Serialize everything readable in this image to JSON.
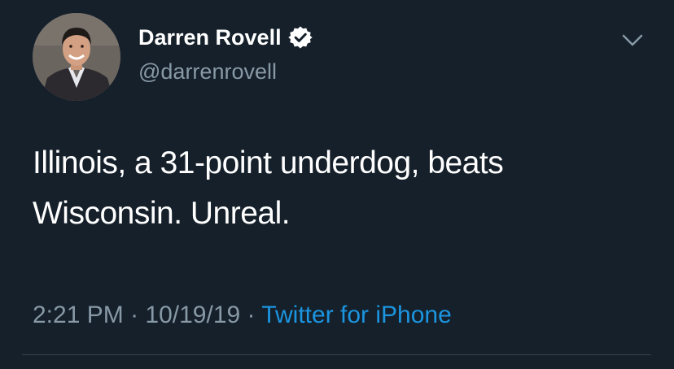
{
  "author": {
    "display_name": "Darren Rovell",
    "handle": "@darrenrovell",
    "verified": true
  },
  "tweet": {
    "text": "Illinois, a 31-point underdog, beats Wisconsin. Unreal.",
    "time": "2:21 PM",
    "separator": "·",
    "date": "10/19/19",
    "source": "Twitter for iPhone"
  },
  "icons": {
    "verified": "verified-badge-icon",
    "menu": "chevron-down-icon"
  },
  "colors": {
    "background": "#15202b",
    "primary_text": "#ffffff",
    "secondary_text": "#8899a6",
    "link": "#1b95e0",
    "divider": "#38444d"
  }
}
